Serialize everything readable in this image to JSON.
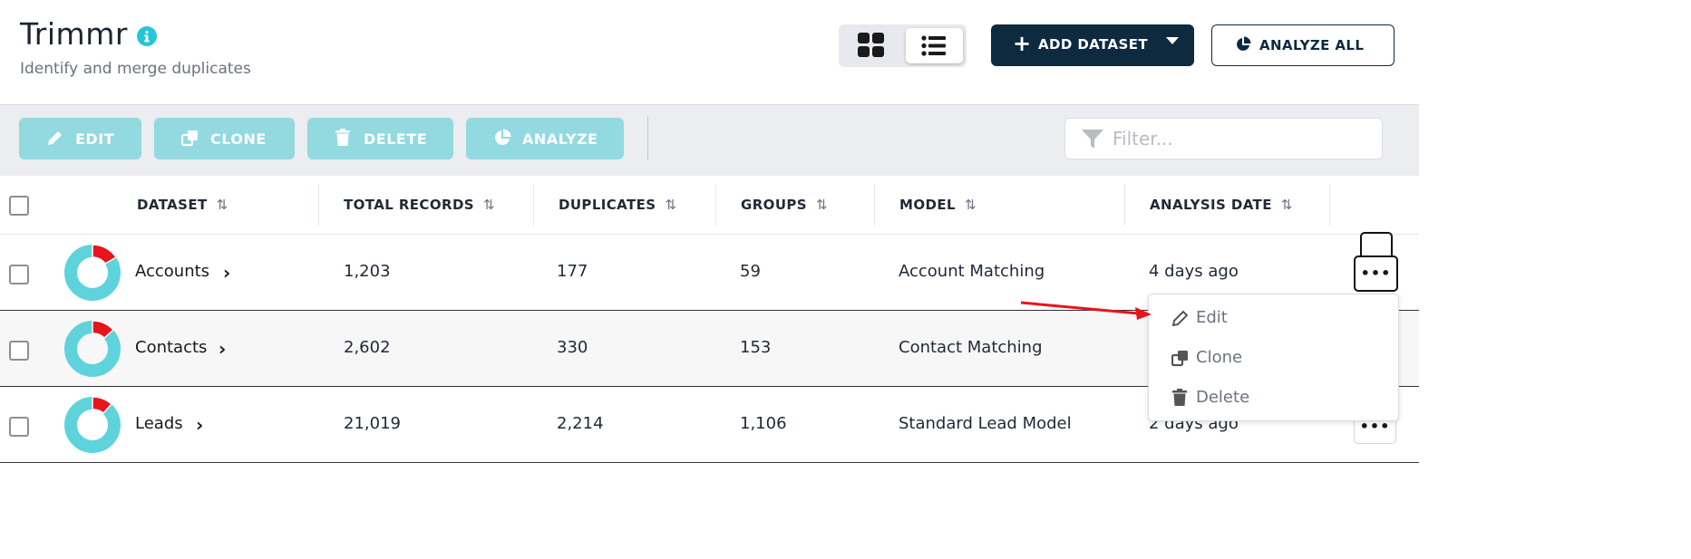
{
  "header": {
    "title": "Trimmr",
    "subtitle": "Identify and merge duplicates",
    "add_dataset_label": "ADD DATASET",
    "analyze_all_label": "ANALYZE ALL"
  },
  "toolbar": {
    "edit_label": "EDIT",
    "clone_label": "CLONE",
    "delete_label": "DELETE",
    "analyze_label": "ANALYZE",
    "filter_placeholder": "Filter..."
  },
  "table": {
    "columns": [
      "DATASET",
      "TOTAL RECORDS",
      "DUPLICATES",
      "GROUPS",
      "MODEL",
      "ANALYSIS DATE"
    ],
    "rows": [
      {
        "dataset": "Accounts",
        "total_records": "1,203",
        "duplicates": "177",
        "groups": "59",
        "model": "Account Matching",
        "analysis_date": "4 days ago"
      },
      {
        "dataset": "Contacts",
        "total_records": "2,602",
        "duplicates": "330",
        "groups": "153",
        "model": "Contact Matching",
        "analysis_date": ""
      },
      {
        "dataset": "Leads",
        "total_records": "21,019",
        "duplicates": "2,214",
        "groups": "1,106",
        "model": "Standard Lead Model",
        "analysis_date": "2 days ago"
      }
    ]
  },
  "row_menu": {
    "items": [
      "Edit",
      "Clone",
      "Delete"
    ]
  },
  "colors": {
    "brand_dark": "#0d2a3f",
    "accent_teal": "#26c6da",
    "toolbar_button": "#93d9e0",
    "donut_main": "#5fd3dc",
    "donut_dup": "#e8141b",
    "annotation_arrow": "#e8141b"
  }
}
